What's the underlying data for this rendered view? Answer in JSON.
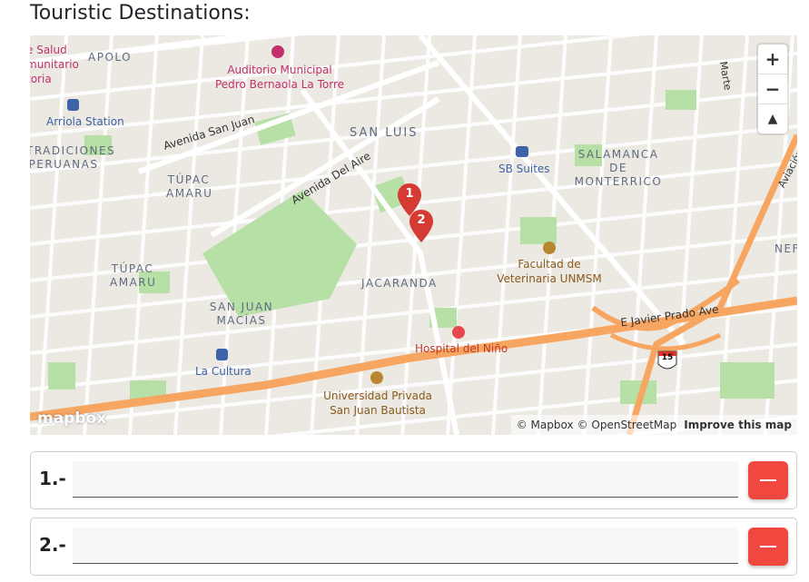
{
  "page": {
    "title": "Touristic Destinations:"
  },
  "map": {
    "districts": [
      "APOLO",
      "SAN LUIS",
      "TÚPAC AMARU",
      "TÚPAC AMARU",
      "SAN JUAN MACÍAS",
      "JACARANDA",
      "SALAMANCA DE MONTERRICO",
      "TRADICIONES PERUANAS",
      "e Salud munitario toria",
      "NEF"
    ],
    "streets": [
      "Avenida San Juan",
      "Avenida Del Aire",
      "E Javier Prado Ave",
      "Marte",
      "Aviación"
    ],
    "pois": {
      "auditorio": "Auditorio Municipal Pedro Bernaola La Torre",
      "arriola": "Arriola Station",
      "sb_suites": "SB Suites",
      "facultad": "Facultad de Veterinaria UNMSM",
      "hospital": "Hospital del Niño",
      "la_cultura": "La Cultura",
      "universidad": "Universidad Privada San Juan Bautista"
    },
    "highway_shield": "15",
    "markers": [
      "1",
      "2"
    ],
    "controls": {
      "zoom_in": "+",
      "zoom_out": "−",
      "reset": "▲"
    },
    "logo": "mapbox",
    "attribution": {
      "mapbox": "© Mapbox",
      "osm": "© OpenStreetMap",
      "improve": "Improve this map"
    }
  },
  "destinations": [
    {
      "label": "1.-",
      "value": "",
      "placeholder": ""
    },
    {
      "label": "2.-",
      "value": "",
      "placeholder": ""
    }
  ]
}
